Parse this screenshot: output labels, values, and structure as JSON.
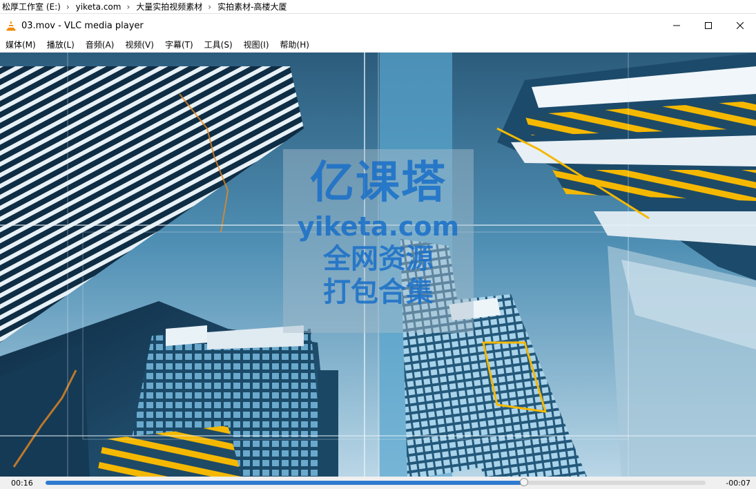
{
  "breadcrumb": {
    "items": [
      "松厚工作室 (E:)",
      "yiketa.com",
      "大量实拍视频素材",
      "实拍素材-高楼大厦"
    ],
    "separator": "›"
  },
  "window": {
    "title": "03.mov - VLC media player",
    "app_icon": "vlc-cone-icon",
    "controls": [
      "minimize-icon",
      "maximize-icon",
      "close-icon"
    ]
  },
  "menu": {
    "items": [
      "媒体(M)",
      "播放(L)",
      "音频(A)",
      "视频(V)",
      "字幕(T)",
      "工具(S)",
      "视图(I)",
      "帮助(H)"
    ]
  },
  "watermark": {
    "title": "亿课塔",
    "url": "yiketa.com",
    "line1": "全网资源",
    "line2": "打包合集"
  },
  "playback": {
    "elapsed": "00:16",
    "remaining": "-00:07",
    "progress_fraction": 0.725
  },
  "colors": {
    "seek_fill": "#2f7bd0",
    "watermark_text": "#196ec8",
    "building_accent": "#f5b800"
  }
}
